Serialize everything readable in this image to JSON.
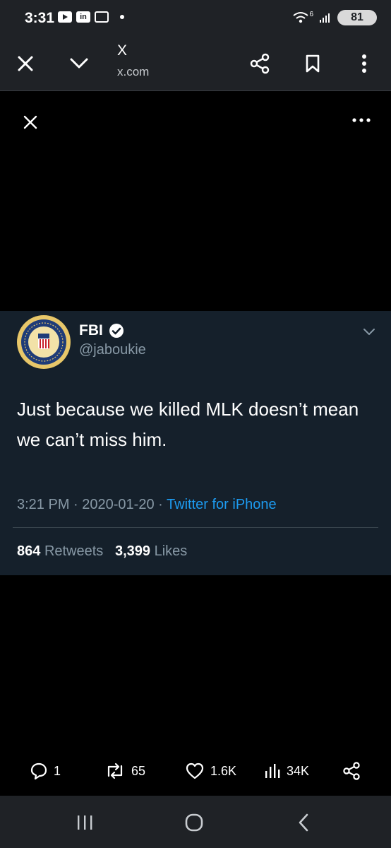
{
  "status_bar": {
    "time": "3:31",
    "battery": "81",
    "network": "6"
  },
  "browser": {
    "title": "X",
    "url": "x.com",
    "icons": [
      "close-icon",
      "chevron-down-icon",
      "share-icon",
      "bookmark-icon",
      "more-vertical-icon"
    ]
  },
  "tweet": {
    "author_name": "FBI",
    "author_handle": "@jaboukie",
    "verified": true,
    "text": "Just because we killed MLK doesn’t mean we can’t miss him.",
    "time": "3:21 PM",
    "date": "2020-01-20",
    "separator": "·",
    "source": "Twitter for iPhone",
    "retweets_count": "864",
    "retweets_label": "Retweets",
    "likes_count": "3,399",
    "likes_label": "Likes"
  },
  "actions": {
    "replies": "1",
    "reposts": "65",
    "likes": "1.6K",
    "views": "34K"
  },
  "colors": {
    "card_bg": "#15202b",
    "link_blue": "#1d9bf0",
    "muted": "#8899a6",
    "bar_bg": "#1f2226"
  }
}
